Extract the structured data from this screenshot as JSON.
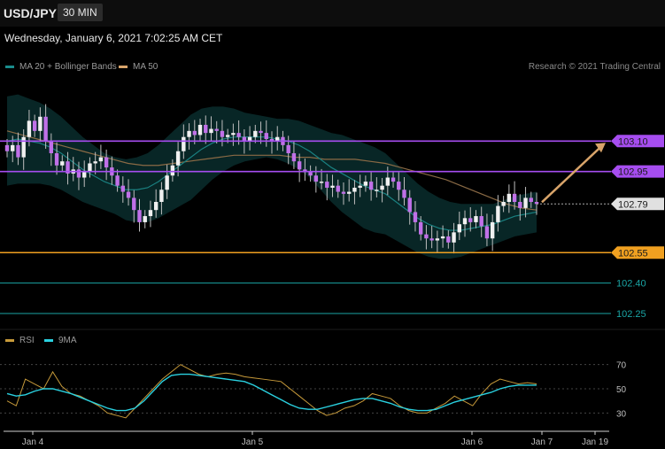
{
  "header": {
    "symbol": "USD/JPY",
    "timeframe": "30 MIN",
    "datetime": "Wednesday, January 6, 2021 7:02:25 AM CET"
  },
  "legend": {
    "ma20_label": "MA 20 + Bollinger Bands",
    "ma50_label": "MA 50",
    "ma20_color": "#1a8c8c",
    "ma50_color": "#d8a46a",
    "credit": "Research © 2021 Trading Central"
  },
  "rsi_legend": {
    "rsi_label": "RSI",
    "ma9_label": "9MA",
    "rsi_color": "#c79a3a",
    "ma9_color": "#2ad1e0"
  },
  "chart_data": [
    {
      "type": "candlestick",
      "title": "USD/JPY",
      "ylim": [
        102.18,
        103.42
      ],
      "x_labels": [
        "Jan 4",
        "Jan 5",
        "Jan 6",
        "Jan 7",
        "Jan 19"
      ],
      "current_price": "102.79",
      "levels": [
        {
          "value": 103.1,
          "label": "103.10",
          "color": "#a64df0",
          "kind": "resistance"
        },
        {
          "value": 102.95,
          "label": "102.95",
          "color": "#a64df0",
          "kind": "resistance"
        },
        {
          "value": 102.55,
          "label": "102.55",
          "color": "#f0a020",
          "kind": "pivot"
        },
        {
          "value": 102.4,
          "label": "102.40",
          "color": "#1aa5a5",
          "kind": "support"
        },
        {
          "value": 102.25,
          "label": "102.25",
          "color": "#1aa5a5",
          "kind": "support"
        }
      ],
      "target_arrow": {
        "from": 102.79,
        "to": 103.1,
        "color": "#d8a46a"
      },
      "series": [
        {
          "name": "Price close (approx.)",
          "values": [
            103.05,
            103.08,
            103.02,
            103.12,
            103.2,
            103.15,
            103.22,
            103.1,
            103.04,
            102.98,
            103.0,
            102.94,
            102.96,
            102.92,
            102.95,
            102.99,
            103.0,
            103.02,
            102.97,
            102.93,
            102.88,
            102.85,
            102.82,
            102.76,
            102.7,
            102.73,
            102.76,
            102.8,
            102.86,
            102.93,
            102.98,
            103.05,
            103.12,
            103.15,
            103.13,
            103.18,
            103.14,
            103.16,
            103.15,
            103.12,
            103.13,
            103.14,
            103.12,
            103.1,
            103.12,
            103.15,
            103.14,
            103.11,
            103.1,
            103.12,
            103.08,
            103.04,
            103.0,
            102.96,
            102.95,
            102.93,
            102.9,
            102.9,
            102.87,
            102.88,
            102.85,
            102.84,
            102.85,
            102.87,
            102.88,
            102.9,
            102.86,
            102.86,
            102.88,
            102.92,
            102.9,
            102.86,
            102.82,
            102.75,
            102.7,
            102.64,
            102.62,
            102.61,
            102.62,
            102.63,
            102.6,
            102.65,
            102.69,
            102.72,
            102.7,
            102.73,
            102.68,
            102.62,
            102.7,
            102.78,
            102.8,
            102.84,
            102.8,
            102.77,
            102.82,
            102.8,
            102.79
          ]
        },
        {
          "name": "MA 20",
          "values": [
            103.1,
            103.11,
            103.1,
            103.09,
            103.07,
            103.04,
            103.0,
            102.96,
            102.93,
            102.9,
            102.88,
            102.86,
            102.86,
            102.87,
            102.9,
            102.94,
            102.98,
            103.02,
            103.06,
            103.09,
            103.11,
            103.12,
            103.12,
            103.12,
            103.12,
            103.11,
            103.1,
            103.08,
            103.05,
            103.01,
            102.97,
            102.94,
            102.91,
            102.88,
            102.86,
            102.84,
            102.8,
            102.76,
            102.72,
            102.69,
            102.67,
            102.66,
            102.66,
            102.67,
            102.68,
            102.69,
            102.71,
            102.73,
            102.74,
            102.75
          ]
        },
        {
          "name": "MA 50",
          "values": [
            103.15,
            103.13,
            103.11,
            103.09,
            103.07,
            103.05,
            103.03,
            103.01,
            102.99,
            102.98,
            102.98,
            102.99,
            103.0,
            103.01,
            103.02,
            103.03,
            103.03,
            103.03,
            103.03,
            103.02,
            103.02,
            103.01,
            103.01,
            103.01,
            103.0,
            102.99,
            102.97,
            102.95,
            102.93,
            102.91,
            102.88,
            102.85,
            102.82,
            102.79,
            102.77,
            102.76
          ]
        }
      ]
    },
    {
      "type": "line",
      "title": "RSI",
      "ylim": [
        20,
        80
      ],
      "y_ticks": [
        30,
        50,
        70
      ],
      "x_labels": [
        "Jan 4",
        "Jan 5",
        "Jan 6",
        "Jan 7",
        "Jan 19"
      ],
      "series": [
        {
          "name": "RSI",
          "values": [
            40,
            36,
            58,
            54,
            50,
            64,
            52,
            46,
            44,
            40,
            36,
            30,
            28,
            26,
            34,
            42,
            50,
            58,
            64,
            70,
            66,
            62,
            60,
            62,
            63,
            62,
            60,
            59,
            58,
            57,
            56,
            50,
            44,
            38,
            32,
            28,
            30,
            34,
            36,
            40,
            46,
            44,
            42,
            36,
            32,
            30,
            30,
            34,
            38,
            44,
            40,
            36,
            46,
            54,
            58,
            56,
            54,
            55,
            54
          ]
        },
        {
          "name": "9MA",
          "values": [
            46,
            44,
            45,
            48,
            50,
            50,
            48,
            46,
            43,
            40,
            37,
            34,
            32,
            32,
            34,
            40,
            48,
            56,
            61,
            62,
            62,
            61,
            60,
            59,
            58,
            57,
            56,
            53,
            49,
            45,
            41,
            37,
            34,
            33,
            33,
            35,
            37,
            39,
            41,
            42,
            42,
            40,
            38,
            35,
            33,
            32,
            32,
            33,
            36,
            39,
            41,
            43,
            45,
            47,
            50,
            52,
            53,
            53,
            53
          ]
        }
      ]
    }
  ]
}
